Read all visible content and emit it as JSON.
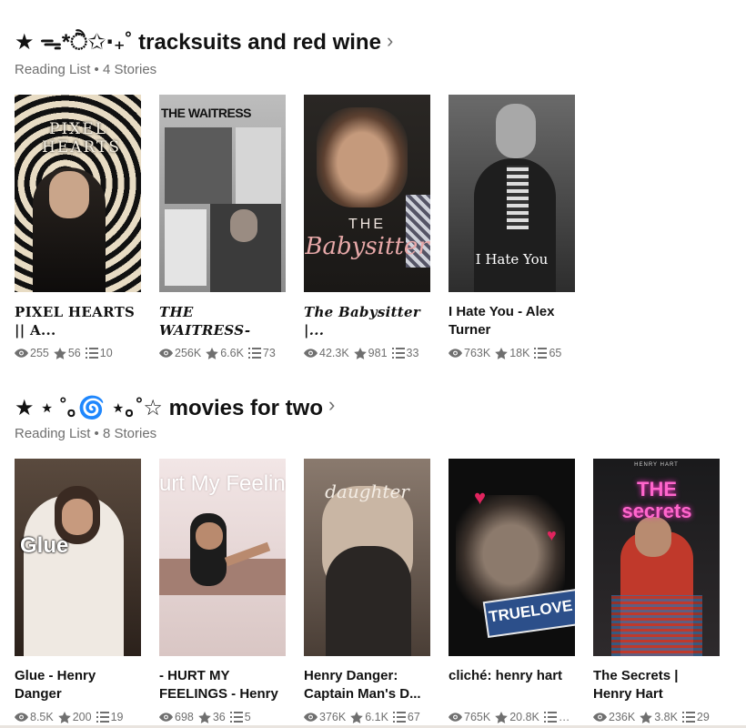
{
  "lists": [
    {
      "title": "★ ᯓ*ੈ✩‧₊˚ tracksuits and red wine",
      "chevron": "›",
      "meta": "Reading List • 4 Stories",
      "stories": [
        {
          "title": "PIXEL HEARTS || A...",
          "style": "serif",
          "cover_text": "PIXEL HEARTS",
          "cover_theme": "swirl",
          "reads": "255",
          "votes": "56",
          "parts": "10"
        },
        {
          "title": "THE WAITRESS- AL�...",
          "style": "serif-italic",
          "cover_text": "THE WAITRESS",
          "cover_theme": "waitress",
          "reads": "256K",
          "votes": "6.6K",
          "parts": "73"
        },
        {
          "title": "The Babysitter |...",
          "style": "serif-italic",
          "cover_text": "Babysitter",
          "cover_theme": "babysitter",
          "reads": "42.3K",
          "votes": "981",
          "parts": "33"
        },
        {
          "title": "I Hate You - Alex Turner",
          "style": "plain",
          "cover_text": "I Hate You",
          "cover_theme": "hate",
          "reads": "763K",
          "votes": "18K",
          "parts": "65"
        }
      ]
    },
    {
      "title": "★ ⋆ ˚｡🌀 ⋆｡˚☆ movies for two",
      "chevron": "›",
      "meta": "Reading List • 8 Stories",
      "stories": [
        {
          "title": "Glue - Henry Danger",
          "style": "plain",
          "cover_text": "Glue",
          "cover_theme": "glue",
          "reads": "8.5K",
          "votes": "200",
          "parts": "19"
        },
        {
          "title": "- HURT MY FEELINGS - Henry",
          "style": "plain",
          "cover_text": "urt My Feelings",
          "cover_theme": "hurt",
          "reads": "698",
          "votes": "36",
          "parts": "5"
        },
        {
          "title": "Henry Danger: Captain Man's D...",
          "style": "plain",
          "cover_text": "daughter",
          "cover_theme": "captain",
          "reads": "376K",
          "votes": "6.1K",
          "parts": "67"
        },
        {
          "title": "cliché: henry hart",
          "style": "plain",
          "cover_text": "TRUELOVE",
          "cover_theme": "cliche",
          "reads": "765K",
          "votes": "20.8K",
          "parts": "…"
        },
        {
          "title": "The Secrets | Henry Hart",
          "style": "plain",
          "cover_text": "THE secrets",
          "cover_theme": "secrets",
          "reads": "236K",
          "votes": "3.8K",
          "parts": "29"
        }
      ]
    }
  ],
  "cover_extra": {
    "waitress_sub": "THE WAITRESS",
    "babysitter_top": "THE",
    "henry_hart": "HENRY HART"
  }
}
